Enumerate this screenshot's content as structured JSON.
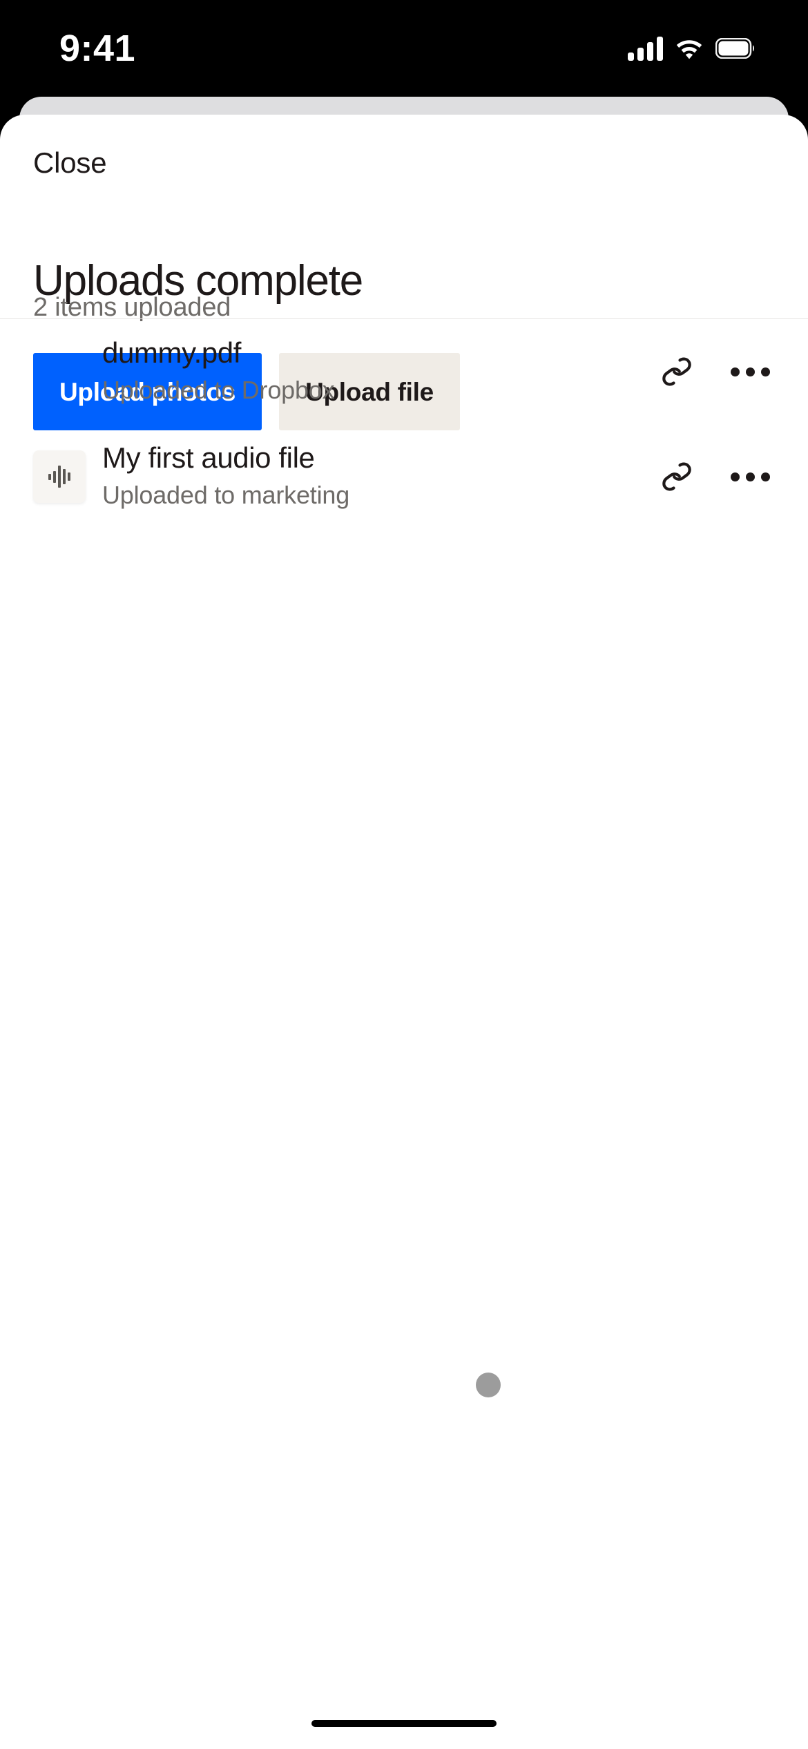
{
  "status_bar": {
    "time": "9:41",
    "signal_icon": "cellular-signal-icon",
    "wifi_icon": "wifi-icon",
    "battery_icon": "battery-icon"
  },
  "sheet": {
    "close_label": "Close",
    "title": "Uploads complete",
    "subtitle": "2 items uploaded",
    "actions": [
      {
        "label": "Upload photos",
        "style": "primary"
      },
      {
        "label": "Upload file",
        "style": "secondary"
      }
    ]
  },
  "file_list": {
    "items": [
      {
        "name": "dummy.pdf",
        "status": "Uploaded to Dropbox",
        "thumb_icon": "none",
        "link_icon": "copy-link-icon",
        "overflow_icon": "more-options-icon"
      },
      {
        "name": "My first audio file",
        "status": "Uploaded to marketing",
        "thumb_icon": "audio-waveform-icon",
        "link_icon": "copy-link-icon",
        "overflow_icon": "more-options-icon"
      }
    ]
  },
  "loading": {
    "indicator_icon": "loading-dot-icon"
  },
  "colors": {
    "primary_button": "#0061fe",
    "secondary_button": "#f0ece6",
    "text_primary": "#1e1919",
    "text_secondary": "#6e6b68",
    "sheet_background": "#ffffff",
    "behind_card": "#dedee0",
    "loading_dot": "#9c9c9c"
  }
}
